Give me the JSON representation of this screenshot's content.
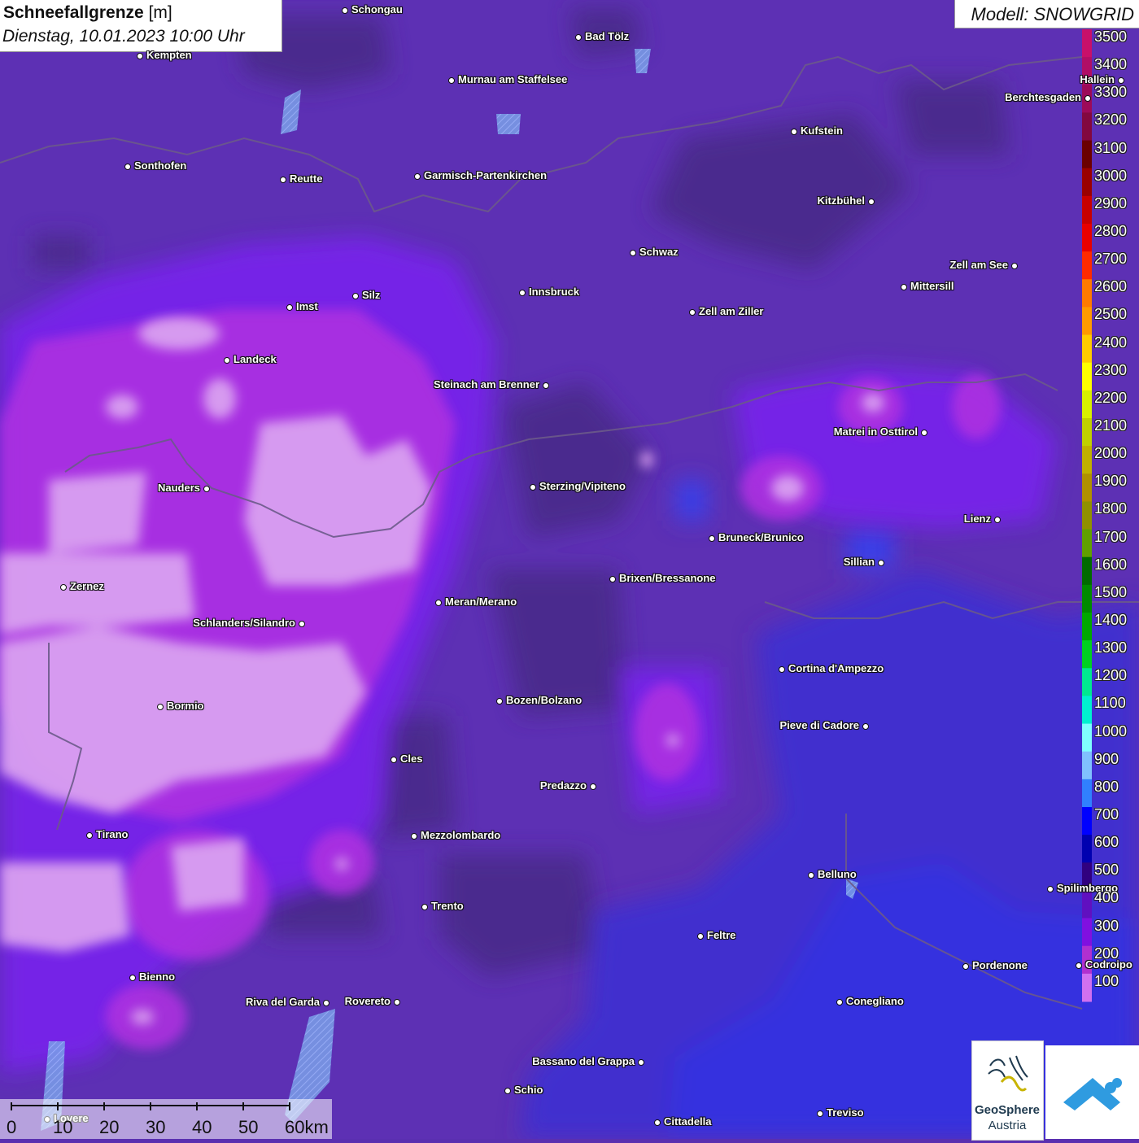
{
  "header": {
    "title_bold": "Schneefallgrenze",
    "title_unit": "[m]",
    "date": "Dienstag, 10.01.2023 10:00 Uhr",
    "model": "Modell: SNOWGRID"
  },
  "cities": [
    {
      "name": "Schongau"
    },
    {
      "name": "Bad Tölz"
    },
    {
      "name": "Kempten"
    },
    {
      "name": "Murnau am Staffelsee"
    },
    {
      "name": "Hallein"
    },
    {
      "name": "Berchtesgaden"
    },
    {
      "name": "Kufstein"
    },
    {
      "name": "Sonthofen"
    },
    {
      "name": "Reutte"
    },
    {
      "name": "Garmisch-Partenkirchen"
    },
    {
      "name": "Kitzbühel"
    },
    {
      "name": "Schwaz"
    },
    {
      "name": "Zell am See"
    },
    {
      "name": "Innsbruck"
    },
    {
      "name": "Mittersill"
    },
    {
      "name": "Silz"
    },
    {
      "name": "Imst"
    },
    {
      "name": "Zell am Ziller"
    },
    {
      "name": "Landeck"
    },
    {
      "name": "Steinach am Brenner"
    },
    {
      "name": "Matrei in Osttirol"
    },
    {
      "name": "Nauders"
    },
    {
      "name": "Sterzing/Vipiteno"
    },
    {
      "name": "Lienz"
    },
    {
      "name": "Bruneck/Brunico"
    },
    {
      "name": "Sillian"
    },
    {
      "name": "Zernez"
    },
    {
      "name": "Brixen/Bressanone"
    },
    {
      "name": "Meran/Merano"
    },
    {
      "name": "Schlanders/Silandro"
    },
    {
      "name": "Cortina d'Ampezzo"
    },
    {
      "name": "Bozen/Bolzano"
    },
    {
      "name": "Bormio"
    },
    {
      "name": "Pieve di Cadore"
    },
    {
      "name": "Cles"
    },
    {
      "name": "Predazzo"
    },
    {
      "name": "Tirano"
    },
    {
      "name": "Mezzolombardo"
    },
    {
      "name": "Belluno"
    },
    {
      "name": "Spilimbergo"
    },
    {
      "name": "Trento"
    },
    {
      "name": "Feltre"
    },
    {
      "name": "Pordenone"
    },
    {
      "name": "Codroipo"
    },
    {
      "name": "Bienno"
    },
    {
      "name": "Riva del Garda"
    },
    {
      "name": "Rovereto"
    },
    {
      "name": "Conegliano"
    },
    {
      "name": "Bassano del Grappa"
    },
    {
      "name": "Schio"
    },
    {
      "name": "Lovere"
    },
    {
      "name": "Treviso"
    },
    {
      "name": "Cittadella"
    }
  ],
  "legend": {
    "levels": [
      {
        "value": "3500",
        "color": "#c8106a"
      },
      {
        "value": "3400",
        "color": "#b00e66"
      },
      {
        "value": "3300",
        "color": "#9c0a58"
      },
      {
        "value": "3200",
        "color": "#82083f"
      },
      {
        "value": "3100",
        "color": "#6a0000"
      },
      {
        "value": "3000",
        "color": "#9a0000"
      },
      {
        "value": "2900",
        "color": "#c80000"
      },
      {
        "value": "2800",
        "color": "#e80000"
      },
      {
        "value": "2700",
        "color": "#ff2a00"
      },
      {
        "value": "2600",
        "color": "#ff7a00"
      },
      {
        "value": "2500",
        "color": "#ff9a00"
      },
      {
        "value": "2400",
        "color": "#ffcc00"
      },
      {
        "value": "2300",
        "color": "#ffff00"
      },
      {
        "value": "2200",
        "color": "#d8f000"
      },
      {
        "value": "2100",
        "color": "#c0d000"
      },
      {
        "value": "2000",
        "color": "#c0b000"
      },
      {
        "value": "1900",
        "color": "#b09000"
      },
      {
        "value": "1800",
        "color": "#909000"
      },
      {
        "value": "1700",
        "color": "#60a000"
      },
      {
        "value": "1600",
        "color": "#006a00"
      },
      {
        "value": "1500",
        "color": "#008a00"
      },
      {
        "value": "1400",
        "color": "#00a800"
      },
      {
        "value": "1300",
        "color": "#00d020"
      },
      {
        "value": "1200",
        "color": "#00e890"
      },
      {
        "value": "1100",
        "color": "#00f0d0"
      },
      {
        "value": "1000",
        "color": "#80ffff"
      },
      {
        "value": "900",
        "color": "#80c0ff"
      },
      {
        "value": "800",
        "color": "#3080ff"
      },
      {
        "value": "700",
        "color": "#0000ff"
      },
      {
        "value": "600",
        "color": "#0000b0"
      },
      {
        "value": "500",
        "color": "#300080"
      },
      {
        "value": "400",
        "color": "#6010c0"
      },
      {
        "value": "300",
        "color": "#8010e0"
      },
      {
        "value": "200",
        "color": "#b030d0"
      },
      {
        "value": "100",
        "color": "#d070f0"
      }
    ]
  },
  "scale": {
    "labels": [
      "0",
      "10",
      "20",
      "30",
      "40",
      "50",
      "60km"
    ]
  },
  "logo": {
    "name": "GeoSphere",
    "sub": "Austria"
  }
}
